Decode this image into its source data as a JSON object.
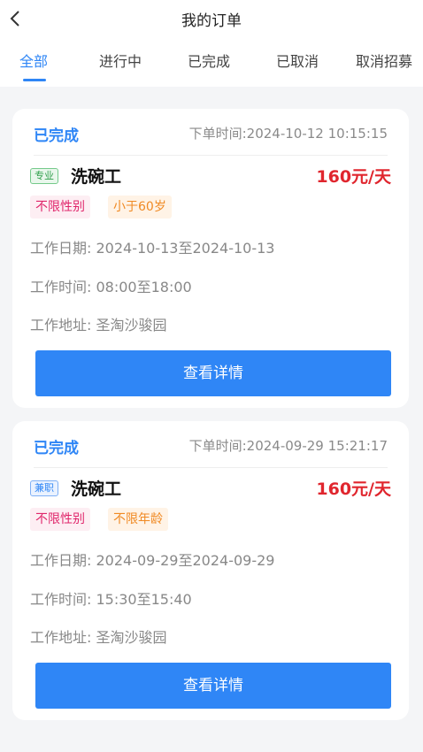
{
  "header": {
    "title": "我的订单",
    "tabs": [
      "全部",
      "进行中",
      "已完成",
      "已取消",
      "取消招募"
    ]
  },
  "orders": [
    {
      "status": "已完成",
      "order_time": "下单时间:2024-10-12 10:15:15",
      "type_badge": "专业",
      "job_title": "洗碗工",
      "price": "160元/天",
      "tags": [
        "不限性别",
        "小于60岁"
      ],
      "work_date_label": "工作日期:",
      "work_date": "2024-10-13至2024-10-13",
      "work_time_label": "工作时间:",
      "work_time": "08:00至18:00",
      "work_addr_label": "工作地址:",
      "work_addr": "圣淘沙骏园",
      "button": "查看详情"
    },
    {
      "status": "已完成",
      "order_time": "下单时间:2024-09-29 15:21:17",
      "type_badge": "兼职",
      "job_title": "洗碗工",
      "price": "160元/天",
      "tags": [
        "不限性别",
        "不限年龄"
      ],
      "work_date_label": "工作日期:",
      "work_date": "2024-09-29至2024-09-29",
      "work_time_label": "工作时间:",
      "work_time": "15:30至15:40",
      "work_addr_label": "工作地址:",
      "work_addr": "圣淘沙骏园",
      "button": "查看详情"
    }
  ],
  "colors": {
    "accent": "#2f86f6",
    "price": "#e0262e",
    "tag_pink": "#e0266b",
    "tag_orange": "#f08a24",
    "badge_green": "#2e9e4a"
  },
  "icons": {
    "back": "chevron-left-icon"
  }
}
